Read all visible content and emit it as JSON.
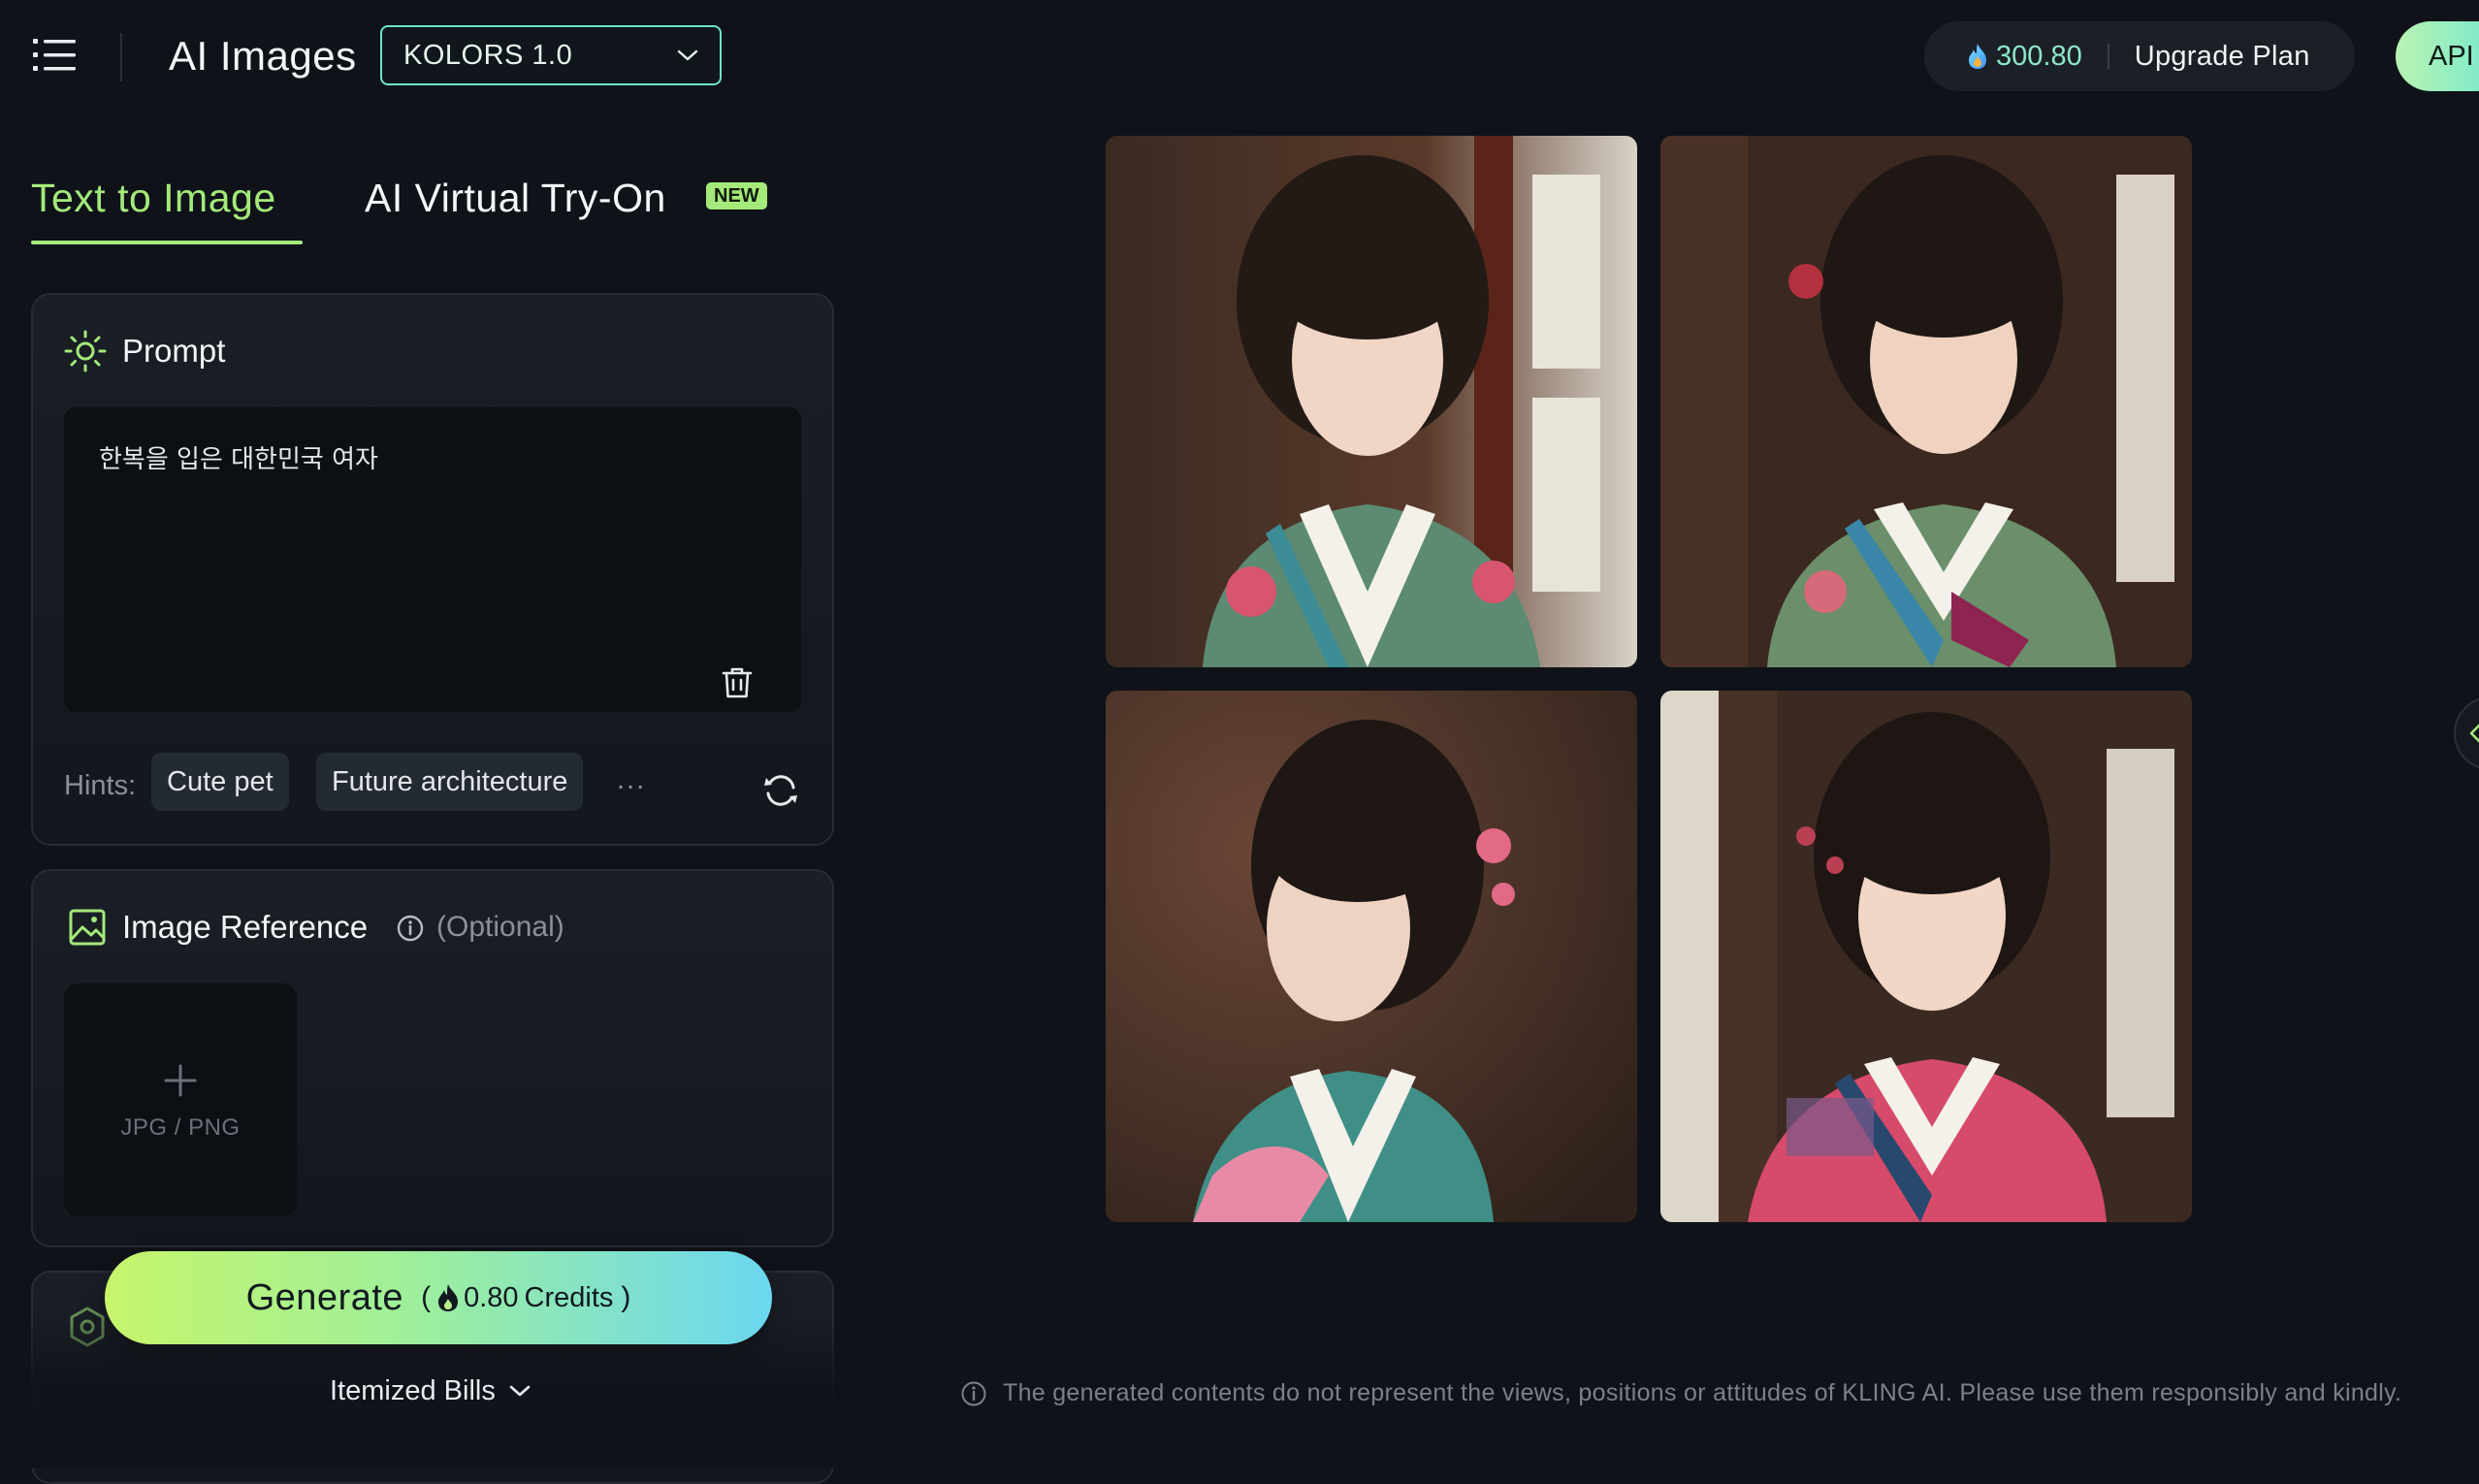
{
  "header": {
    "app_title": "AI Images",
    "model_select": {
      "value": "KOLORS 1.0"
    },
    "credits": "300.80",
    "upgrade_label": "Upgrade Plan",
    "api_label": "API"
  },
  "tabs": [
    {
      "label": "Text to Image",
      "active": true
    },
    {
      "label": "AI Virtual Try-On",
      "badge": "NEW",
      "active": false
    }
  ],
  "prompt": {
    "title": "Prompt",
    "text": "한복을 입은 대한민국 여자",
    "hints_label": "Hints:",
    "hints": [
      "Cute pet",
      "Future architecture"
    ],
    "more": "..."
  },
  "image_reference": {
    "title": "Image Reference",
    "optional": "(Optional)",
    "upload_label": "JPG / PNG"
  },
  "generate": {
    "label": "Generate",
    "open_paren": "(",
    "cost": "0.80",
    "unit": "Credits",
    "close_paren": ")"
  },
  "itemized_bills": "Itemized Bills",
  "results": {
    "images": [
      {
        "description": "Korean woman in green floral hanbok"
      },
      {
        "description": "Korean woman in green hanbok with blue collar"
      },
      {
        "description": "Korean woman in teal hanbok with pink ribbon"
      },
      {
        "description": "Korean woman in pink hanbok"
      }
    ]
  },
  "disclaimer": "The generated contents do not represent the views, positions or attitudes of KLING AI. Please use them responsibly and kindly.",
  "colors": {
    "accent": "#a4e97a",
    "background": "#0f1319",
    "panel": "#1a1f26"
  }
}
